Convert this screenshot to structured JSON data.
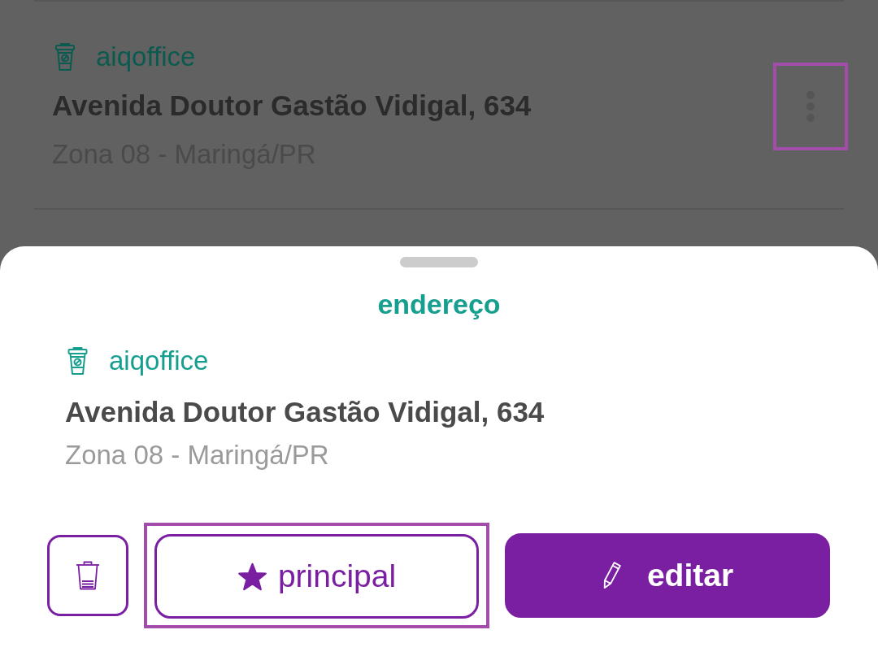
{
  "background_card": {
    "store": "aiqoffice",
    "street": "Avenida Doutor Gastão Vidigal, 634",
    "area": "Zona 08 - Maringá/PR",
    "menu": {
      "highlighted": true
    }
  },
  "sheet": {
    "title": "endereço",
    "store": "aiqoffice",
    "street": "Avenida Doutor Gastão Vidigal, 634",
    "area": "Zona 08 - Maringá/PR",
    "buttons": [
      {
        "kind": "delete",
        "highlighted": false
      },
      {
        "kind": "favorite",
        "label": "principal",
        "highlighted": true
      },
      {
        "kind": "edit",
        "label": "editar",
        "highlighted": false
      }
    ]
  }
}
